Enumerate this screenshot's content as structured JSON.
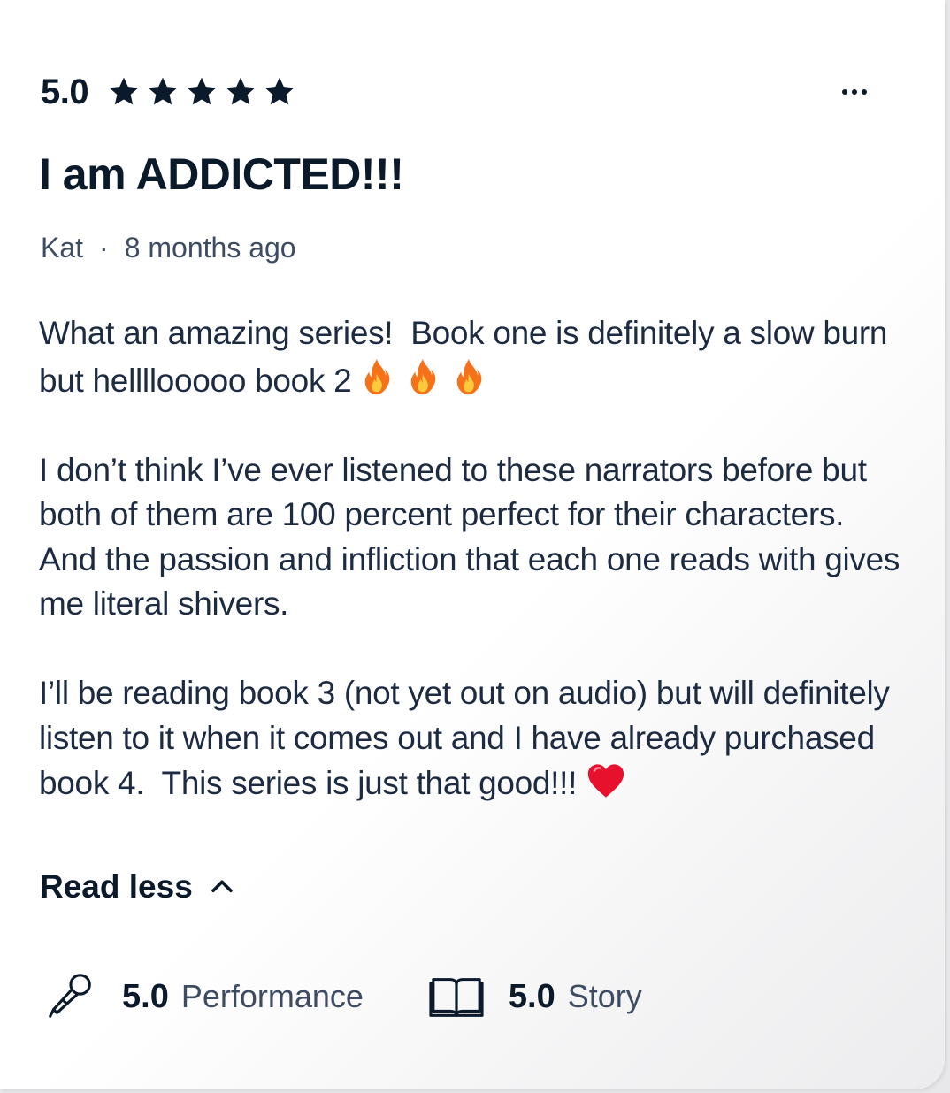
{
  "review": {
    "overall_rating": "5.0",
    "stars": 5,
    "title": "I am ADDICTED!!!",
    "author": "Kat",
    "separator": "·",
    "posted": "8 months ago",
    "body": {
      "p1_text": "What an amazing series!  Book one is definitely a slow burn but hellllooooo book 2",
      "p2_text": "I don’t think I’ve ever listened to these narrators before but both of them are 100 percent perfect for their characters.  And the passion and infliction that each one reads with gives me literal shivers.",
      "p3_text": "I’ll be reading book 3 (not yet out on audio) but will definitely listen to it when it comes out and I have already purchased book 4.  This series is just that good!!!"
    },
    "toggle_label": "Read less",
    "sub_ratings": [
      {
        "value": "5.0",
        "label": "Performance",
        "icon": "microphone-icon"
      },
      {
        "value": "5.0",
        "label": "Story",
        "icon": "open-book-icon"
      }
    ]
  },
  "colors": {
    "text_primary": "#0b1a2b",
    "text_secondary": "#3d4b63",
    "star": "#0b1a2b",
    "fire": "#f5721b",
    "heart": "#e8112d"
  },
  "icons": {
    "rating": "star-icon",
    "more": "more-options-icon",
    "paragraph1_emoji": "fire-emoji",
    "paragraph3_emoji": "red-heart-emoji",
    "toggle": "chevron-up-icon"
  }
}
